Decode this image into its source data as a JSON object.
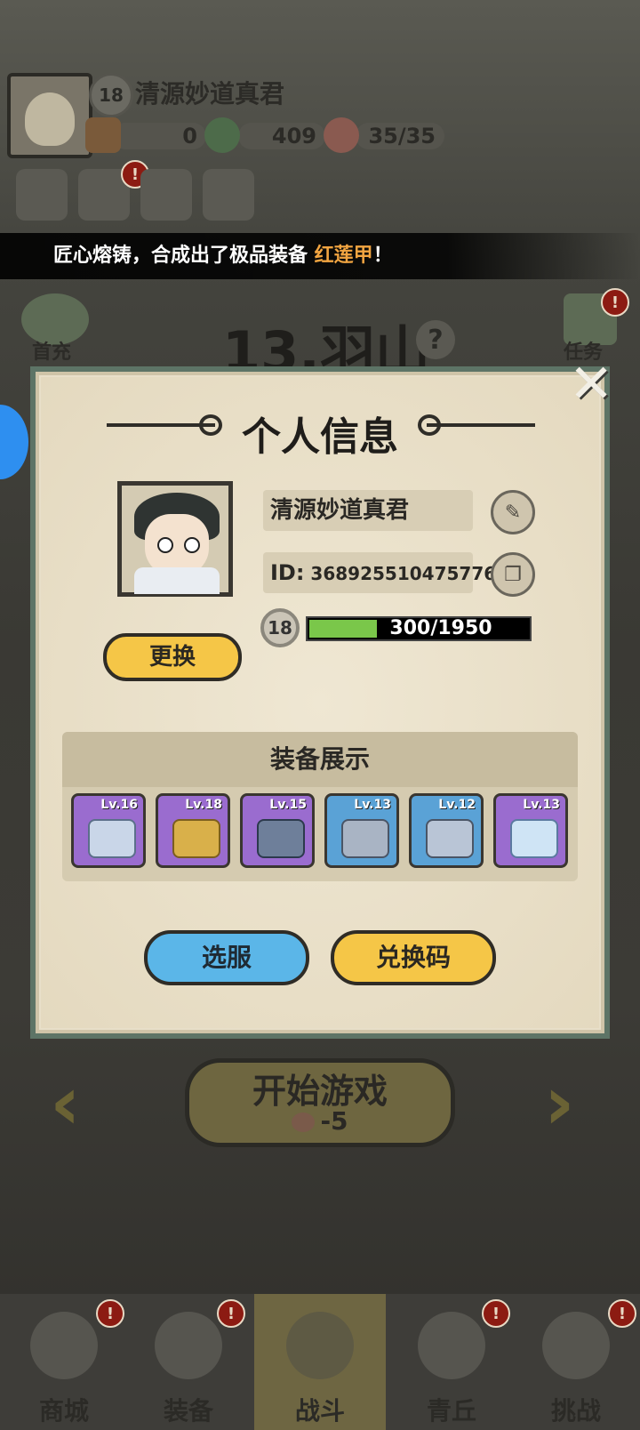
{
  "colors": {
    "panel_bg": "#e8dfc9",
    "panel_border": "#5d7466",
    "button_yellow": "#f5c647",
    "button_blue": "#5bb6e8",
    "xp_fill": "#7ac74a",
    "marquee_highlight": "#f2a541",
    "badge_red": "#8c1b12"
  },
  "top": {
    "level": "18",
    "player_name": "清源妙道真君",
    "resources": [
      {
        "icon": "jade-stamp-icon",
        "value": "0"
      },
      {
        "icon": "dragon-coin-icon",
        "value": "409"
      },
      {
        "icon": "peach-energy-icon",
        "value": "35/35"
      }
    ],
    "badge": "!"
  },
  "marquee": {
    "prefix": "匠心熔铸，合成出了极品装备 ",
    "highlight": "红莲甲",
    "suffix": "！"
  },
  "side": {
    "left_label": "首充",
    "right_label": "任务"
  },
  "stage": {
    "title": "13.羽山",
    "help": "?"
  },
  "dialog": {
    "title": "个人信息",
    "close": "✕",
    "name": "清源妙道真君",
    "id_label": "ID:",
    "id_value": "368925510475776",
    "level": "18",
    "xp_text": "300/1950",
    "xp_current": 300,
    "xp_max": 1950,
    "change_button": "更换",
    "equipment_title": "装备展示",
    "equipment": [
      {
        "level": "Lv.16",
        "rarity": "purple",
        "icon": "crossbow-icon"
      },
      {
        "level": "Lv.18",
        "rarity": "purple",
        "icon": "helmet-icon"
      },
      {
        "level": "Lv.15",
        "rarity": "purple",
        "icon": "armor-icon"
      },
      {
        "level": "Lv.13",
        "rarity": "blue",
        "icon": "belt-icon"
      },
      {
        "level": "Lv.12",
        "rarity": "blue",
        "icon": "boots-icon"
      },
      {
        "level": "Lv.13",
        "rarity": "purple",
        "icon": "pendant-icon"
      }
    ],
    "server_button": "选服",
    "redeem_button": "兑换码"
  },
  "start": {
    "label": "开始游戏",
    "cost": "-5"
  },
  "nav": [
    {
      "label": "商城",
      "icon": "shop-icon",
      "active": false,
      "badge": true
    },
    {
      "label": "装备",
      "icon": "equipment-icon",
      "active": false,
      "badge": true
    },
    {
      "label": "战斗",
      "icon": "crossed-swords-icon",
      "active": true,
      "badge": false
    },
    {
      "label": "青丘",
      "icon": "mountain-icon",
      "active": false,
      "badge": true
    },
    {
      "label": "挑战",
      "icon": "challenge-icon",
      "active": false,
      "badge": true
    }
  ]
}
